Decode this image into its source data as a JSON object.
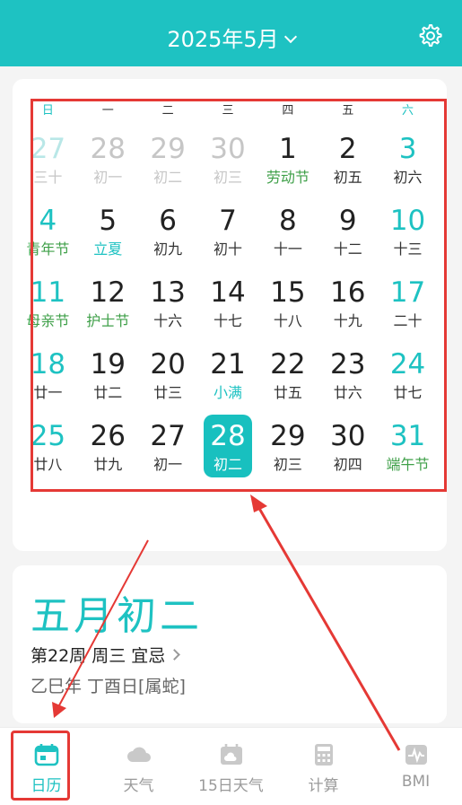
{
  "header": {
    "title": "2025年5月",
    "accent": "#1ec2c2",
    "settings_icon": "gear-icon"
  },
  "weekdays": [
    "日",
    "一",
    "二",
    "三",
    "四",
    "五",
    "六"
  ],
  "days": [
    {
      "num": "27",
      "sub": "三十",
      "other": true
    },
    {
      "num": "28",
      "sub": "初一",
      "other": true
    },
    {
      "num": "29",
      "sub": "初二",
      "other": true
    },
    {
      "num": "30",
      "sub": "初三",
      "other": true
    },
    {
      "num": "1",
      "sub": "劳动节",
      "festival": true
    },
    {
      "num": "2",
      "sub": "初五"
    },
    {
      "num": "3",
      "sub": "初六"
    },
    {
      "num": "4",
      "sub": "青年节",
      "festival": true
    },
    {
      "num": "5",
      "sub": "立夏",
      "term": true
    },
    {
      "num": "6",
      "sub": "初九"
    },
    {
      "num": "7",
      "sub": "初十"
    },
    {
      "num": "8",
      "sub": "十一"
    },
    {
      "num": "9",
      "sub": "十二"
    },
    {
      "num": "10",
      "sub": "十三"
    },
    {
      "num": "11",
      "sub": "母亲节",
      "festival": true
    },
    {
      "num": "12",
      "sub": "护士节",
      "festival": true
    },
    {
      "num": "13",
      "sub": "十六"
    },
    {
      "num": "14",
      "sub": "十七"
    },
    {
      "num": "15",
      "sub": "十八"
    },
    {
      "num": "16",
      "sub": "十九"
    },
    {
      "num": "17",
      "sub": "二十"
    },
    {
      "num": "18",
      "sub": "廿一"
    },
    {
      "num": "19",
      "sub": "廿二"
    },
    {
      "num": "20",
      "sub": "廿三"
    },
    {
      "num": "21",
      "sub": "小满",
      "term": true
    },
    {
      "num": "22",
      "sub": "廿五"
    },
    {
      "num": "23",
      "sub": "廿六"
    },
    {
      "num": "24",
      "sub": "廿七"
    },
    {
      "num": "25",
      "sub": "廿八"
    },
    {
      "num": "26",
      "sub": "廿九"
    },
    {
      "num": "27",
      "sub": "初一"
    },
    {
      "num": "28",
      "sub": "初二",
      "selected": true
    },
    {
      "num": "29",
      "sub": "初三"
    },
    {
      "num": "30",
      "sub": "初四"
    },
    {
      "num": "31",
      "sub": "端午节",
      "festival": true
    }
  ],
  "info": {
    "lunar_date": "五月初二",
    "line1": "第22周 周三 宜忌",
    "line2": "乙巳年 丁酉日[属蛇]"
  },
  "tabs": [
    {
      "label": "日历",
      "icon": "calendar-icon",
      "active": true
    },
    {
      "label": "天气",
      "icon": "cloud-icon"
    },
    {
      "label": "15日天气",
      "icon": "weather-calendar-icon"
    },
    {
      "label": "计算",
      "icon": "calculator-icon"
    },
    {
      "label": "BMI",
      "icon": "heartbeat-icon"
    }
  ],
  "colors": {
    "festival": "#3fa049",
    "annotation": "#e53935"
  }
}
